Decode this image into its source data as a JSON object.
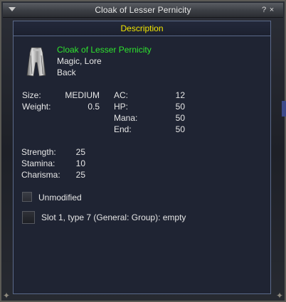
{
  "window": {
    "title": "Cloak of Lesser Pernicity",
    "help_label": "?",
    "close_label": "×"
  },
  "panel": {
    "header": "Description"
  },
  "item": {
    "name": "Cloak of Lesser Pernicity",
    "tags": "Magic, Lore",
    "slot": "Back",
    "icon": "cloak-icon"
  },
  "stats": {
    "size_label": "Size:",
    "size_value": "MEDIUM",
    "weight_label": "Weight:",
    "weight_value": "0.5",
    "ac_label": "AC:",
    "ac_value": "12",
    "hp_label": "HP:",
    "hp_value": "50",
    "mana_label": "Mana:",
    "mana_value": "50",
    "end_label": "End:",
    "end_value": "50",
    "strength_label": "Strength:",
    "strength_value": "25",
    "stamina_label": "Stamina:",
    "stamina_value": "10",
    "charisma_label": "Charisma:",
    "charisma_value": "25"
  },
  "modifiers": {
    "unmodified_label": "Unmodified",
    "slot_label": "Slot 1, type 7 (General: Group): empty"
  },
  "colors": {
    "title_text": "#e6e6e6",
    "header_text": "#f2e600",
    "item_name": "#2ee42e",
    "panel_border": "#5b6a8a"
  }
}
